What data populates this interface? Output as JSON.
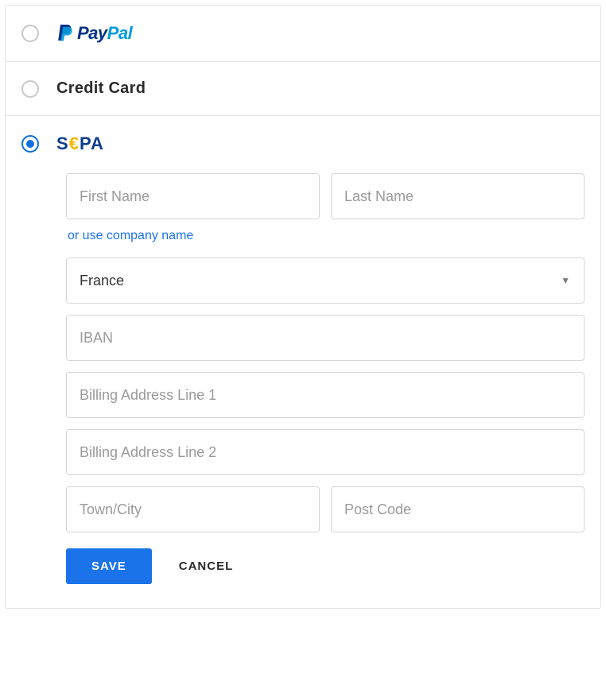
{
  "options": {
    "paypal": {
      "pay": "Pay",
      "pal": "Pal"
    },
    "credit_card": {
      "label": "Credit Card"
    },
    "sepa": {
      "s": "S",
      "e": "€",
      "p": "P",
      "a": "A"
    }
  },
  "form": {
    "first_name_placeholder": "First Name",
    "last_name_placeholder": "Last Name",
    "company_link": "or use company name",
    "country_value": "France",
    "iban_placeholder": "IBAN",
    "address1_placeholder": "Billing Address Line 1",
    "address2_placeholder": "Billing Address Line 2",
    "city_placeholder": "Town/City",
    "postcode_placeholder": "Post Code"
  },
  "buttons": {
    "save": "SAVE",
    "cancel": "CANCEL"
  }
}
